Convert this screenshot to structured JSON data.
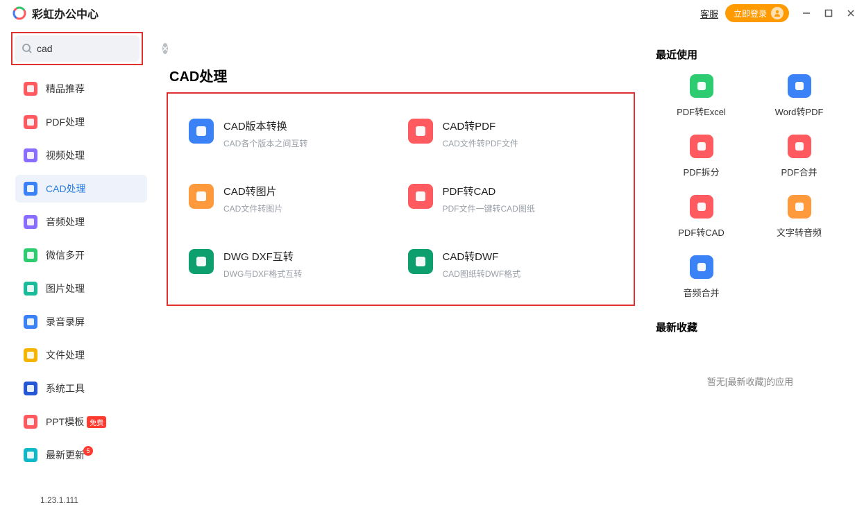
{
  "titlebar": {
    "app_title": "彩虹办公中心",
    "kefu": "客服",
    "login": "立即登录"
  },
  "search": {
    "value": "cad",
    "placeholder": ""
  },
  "sidebar": {
    "items": [
      {
        "label": "精品推荐",
        "icon_bg": "bg-red"
      },
      {
        "label": "PDF处理",
        "icon_bg": "bg-red"
      },
      {
        "label": "视频处理",
        "icon_bg": "bg-purple"
      },
      {
        "label": "CAD处理",
        "icon_bg": "bg-blue",
        "active": true
      },
      {
        "label": "音频处理",
        "icon_bg": "bg-purple"
      },
      {
        "label": "微信多开",
        "icon_bg": "bg-green"
      },
      {
        "label": "图片处理",
        "icon_bg": "bg-teal"
      },
      {
        "label": "录音录屏",
        "icon_bg": "bg-blue"
      },
      {
        "label": "文件处理",
        "icon_bg": "bg-yellow"
      },
      {
        "label": "系统工具",
        "icon_bg": "bg-dkblue"
      },
      {
        "label": "PPT模板",
        "icon_bg": "bg-red",
        "badge": "免费"
      },
      {
        "label": "最新更新",
        "icon_bg": "bg-cyan",
        "dot": "5"
      }
    ],
    "version": "1.23.1.111"
  },
  "main": {
    "title": "CAD处理",
    "tools": [
      {
        "title": "CAD版本转换",
        "desc": "CAD各个版本之间互转",
        "icon_bg": "bg-blue"
      },
      {
        "title": "CAD转PDF",
        "desc": "CAD文件转PDF文件",
        "icon_bg": "bg-red"
      },
      {
        "title": "CAD转图片",
        "desc": "CAD文件转图片",
        "icon_bg": "bg-orange"
      },
      {
        "title": "PDF转CAD",
        "desc": "PDF文件一键转CAD图纸",
        "icon_bg": "bg-red"
      },
      {
        "title": "DWG DXF互转",
        "desc": "DWG与DXF格式互转",
        "icon_bg": "bg-green2"
      },
      {
        "title": "CAD转DWF",
        "desc": "CAD图纸转DWF格式",
        "icon_bg": "bg-green2"
      }
    ]
  },
  "right": {
    "recent_title": "最近使用",
    "recent": [
      {
        "label": "PDF转Excel",
        "icon_bg": "bg-green"
      },
      {
        "label": "Word转PDF",
        "icon_bg": "bg-blue"
      },
      {
        "label": "PDF拆分",
        "icon_bg": "bg-red"
      },
      {
        "label": "PDF合并",
        "icon_bg": "bg-red"
      },
      {
        "label": "PDF转CAD",
        "icon_bg": "bg-red"
      },
      {
        "label": "文字转音频",
        "icon_bg": "bg-orange"
      },
      {
        "label": "音频合并",
        "icon_bg": "bg-blue"
      }
    ],
    "fav_title": "最新收藏",
    "fav_empty": "暂无[最新收藏]的应用"
  }
}
